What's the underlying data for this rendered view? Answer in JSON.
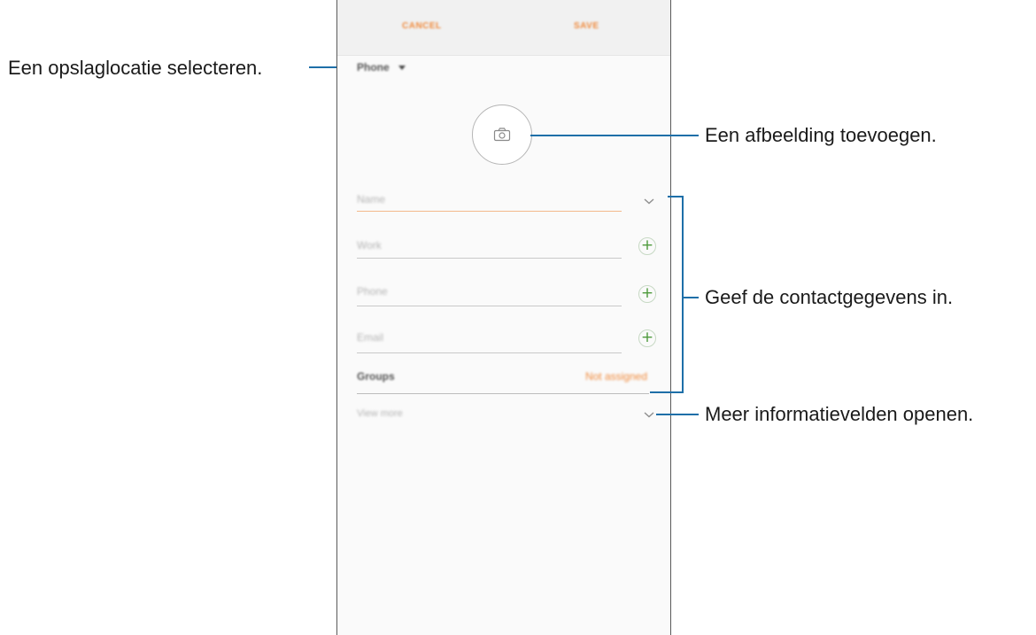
{
  "toolbar": {
    "cancel_label": "CANCEL",
    "save_label": "SAVE"
  },
  "storage": {
    "selected": "Phone"
  },
  "form": {
    "name_placeholder": "Name",
    "work_placeholder": "Work",
    "phone_placeholder": "Phone",
    "email_placeholder": "Email",
    "groups_label": "Groups",
    "groups_value": "Not assigned",
    "view_more": "View more"
  },
  "callouts": {
    "storage": "Een opslaglocatie selecteren.",
    "image": "Een afbeelding toevoegen.",
    "contact": "Geef de contactgegevens in.",
    "more": "Meer informatievelden openen."
  },
  "colors": {
    "accent": "#f08a3c",
    "callout_line": "#1e6fa8",
    "add_icon": "#4e9a3c"
  },
  "icons": {
    "storage_dropdown": "caret-down-icon",
    "photo": "camera-icon",
    "name_expand": "chevron-down-icon",
    "add": "plus-icon",
    "view_more": "chevron-down-icon"
  }
}
